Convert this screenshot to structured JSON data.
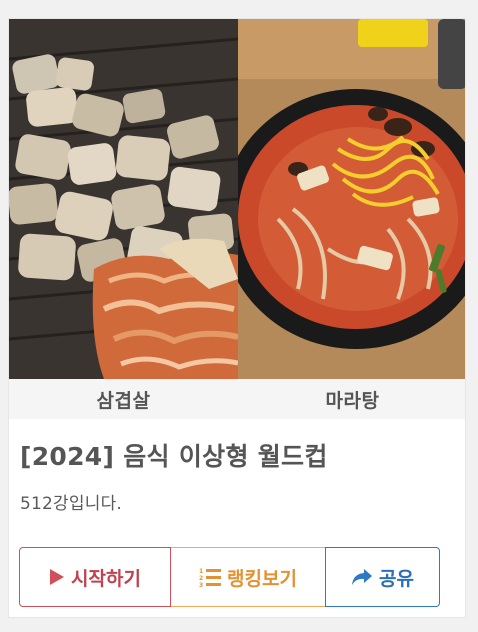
{
  "options": [
    {
      "name": "삼겹살"
    },
    {
      "name": "마라탕"
    }
  ],
  "title": "[2024] 음식 이상형 월드컵",
  "description": "512강입니다.",
  "buttons": {
    "start": {
      "label": "시작하기",
      "icon": "play-icon",
      "color": "#c2414e"
    },
    "ranking": {
      "label": "랭킹보기",
      "icon": "ranked-list-icon",
      "color": "#e39232"
    },
    "share": {
      "label": "공유",
      "icon": "share-arrow-icon",
      "color": "#2b6fb6"
    }
  }
}
